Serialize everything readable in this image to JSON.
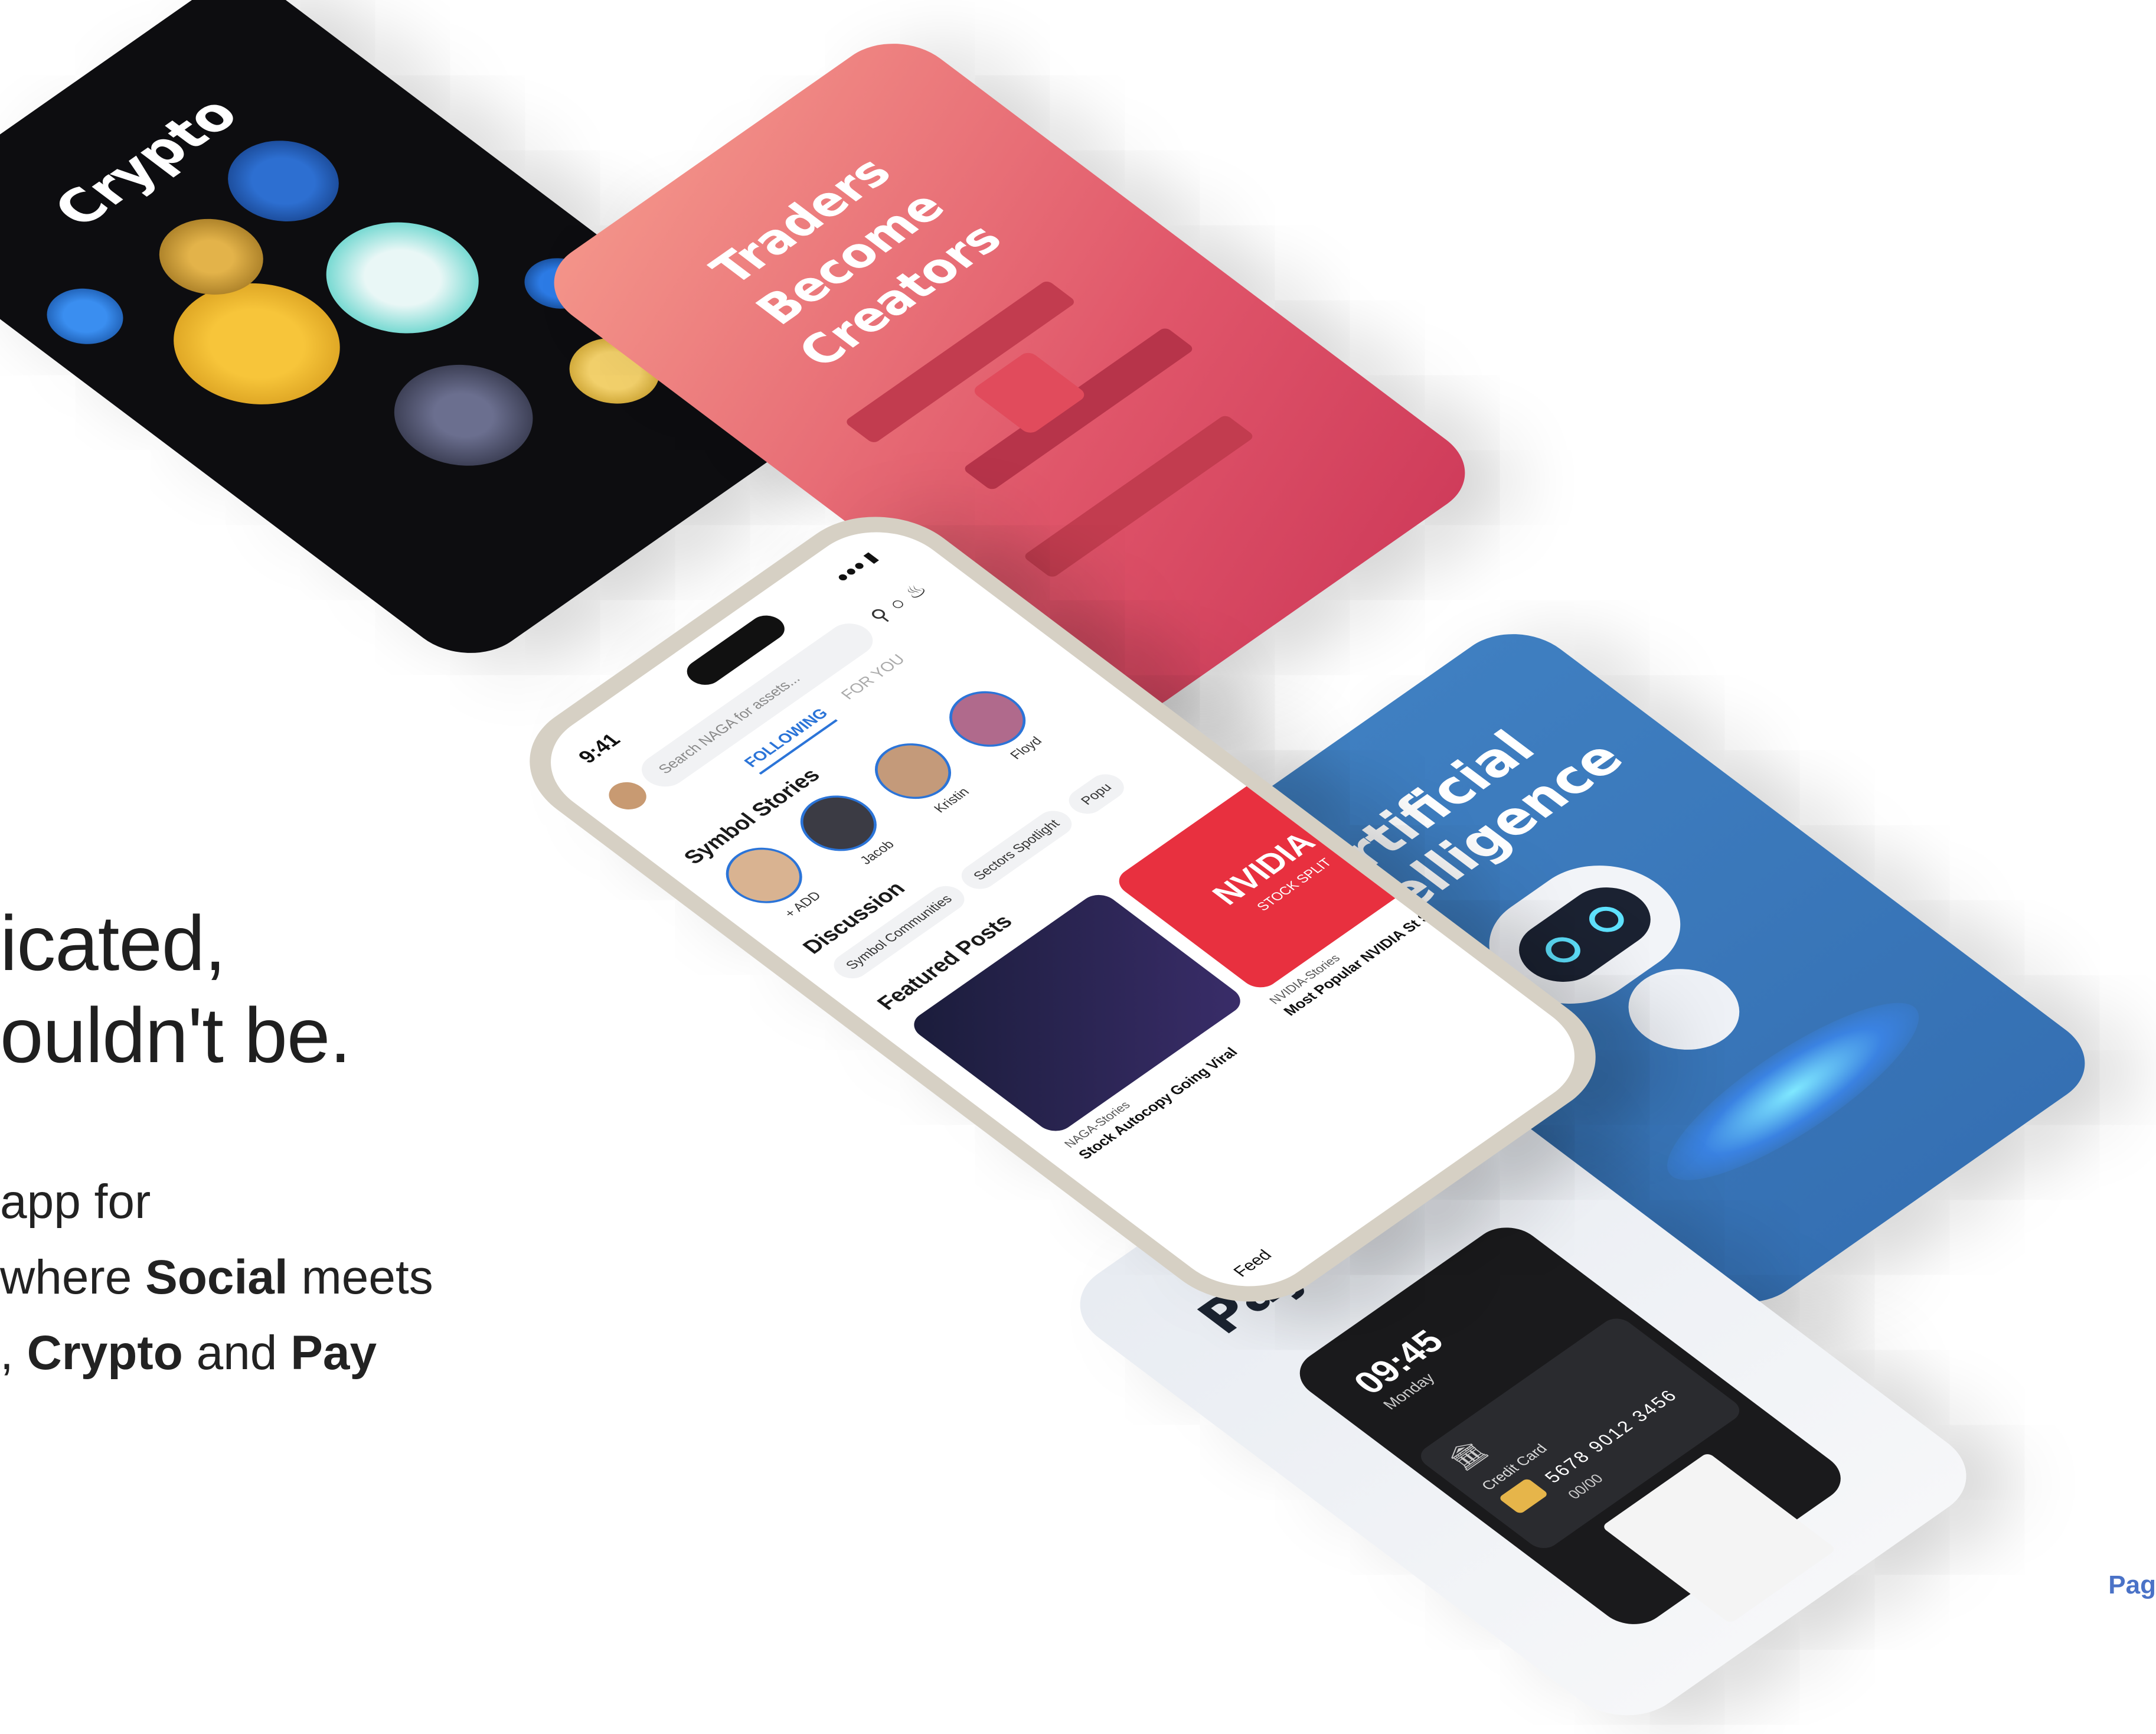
{
  "hero": {
    "line1": "icated,",
    "line2": "ouldn't be.",
    "body_line1": "app for",
    "body_line2_pre": " where ",
    "body_line2_bold": "Social",
    "body_line2_post": " meets",
    "body_line3_pre": ", ",
    "body_line3_bold1": "Crypto",
    "body_line3_mid": " and ",
    "body_line3_bold2": "Pay"
  },
  "pager": "Pag",
  "cards": {
    "crypto": "Crypto",
    "traders": "Traders Become Creators",
    "ai": "Artificial intelligence",
    "payments": "Payments"
  },
  "payments_card": {
    "time": "09:45",
    "day": "Monday",
    "card_label": "Credit Card",
    "card_number": "5678 9012 3456",
    "expiry": "00/00"
  },
  "phone": {
    "time": "9:41",
    "search_placeholder": "Search NAGA for assets...",
    "tab_following": "FOLLOWING",
    "tab_foryou": "FOR YOU",
    "symbol_stories": "Symbol Stories",
    "stories": [
      "+ ADD",
      "Jacob",
      "Kristin",
      "Floyd"
    ],
    "discussion": "Discussion",
    "chips": [
      "Symbol Communities",
      "Sectors Spotlight",
      "Popu"
    ],
    "featured_posts": "Featured Posts",
    "posts": [
      {
        "source": "NAGA-Stories",
        "title": "Stock Autocopy Going Viral"
      },
      {
        "source": "NVIDIA-Stories",
        "title": "Most Popular NVIDIA St Split"
      }
    ],
    "nvidia_banner": "NVIDIA",
    "nvidia_sub": "STOCK SPLIT",
    "feed": "Feed"
  },
  "colors": {
    "crypto_bg": "#0d0d10",
    "traders_bg": "#e0566a",
    "ai_bg": "#3f7fc1",
    "payments_bg": "#e8ecf2",
    "accent": "#2b74d8"
  }
}
